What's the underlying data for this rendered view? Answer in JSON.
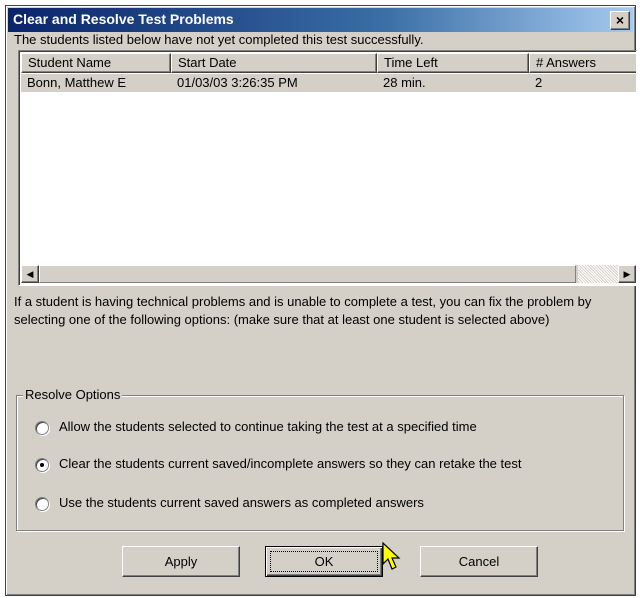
{
  "window": {
    "title": "Clear and Resolve Test Problems",
    "close_glyph": "×"
  },
  "intro_text": "The students listed below have not yet completed this test successfully.",
  "list": {
    "columns": [
      "Student Name",
      "Start Date",
      "Time Left",
      "# Answers"
    ],
    "rows": [
      {
        "name": "Bonn, Matthew E",
        "start": "01/03/03 3:26:35 PM",
        "time_left": "28 min.",
        "answers": "2"
      }
    ]
  },
  "help_text": "If a student is having technical problems and is unable to complete a test, you can fix the problem by selecting one of the following options:  (make sure that at least one student is selected above)",
  "resolve_options": {
    "legend": "Resolve Options",
    "options": [
      {
        "label": "Allow the students selected to continue taking the test at a specified time",
        "selected": false
      },
      {
        "label": "Clear the students current saved/incomplete answers so they can retake the test",
        "selected": true
      },
      {
        "label": "Use the students current saved answers as completed answers",
        "selected": false
      }
    ]
  },
  "buttons": {
    "apply": "Apply",
    "ok": "OK",
    "cancel": "Cancel"
  },
  "colors": {
    "titlebar_start": "#0a246a",
    "face": "#d4d0c8",
    "cursor": "#ffff00"
  }
}
